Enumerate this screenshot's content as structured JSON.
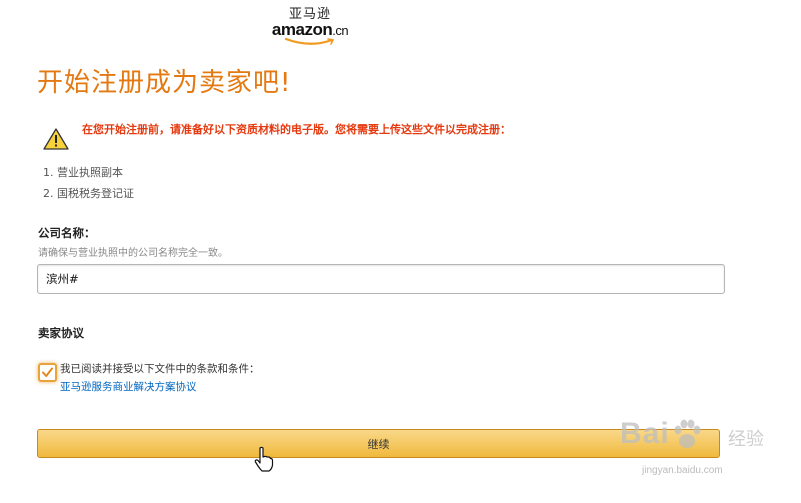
{
  "logo": {
    "cn_text": "亚马逊",
    "brand": "amazon",
    "domain_suffix": ".cn",
    "color": "#111111"
  },
  "page_title": "开始注册成为卖家吧!",
  "warning": {
    "icon": "warning-triangle-icon",
    "text": "在您开始注册前，请准备好以下资质材料的电子版。您将需要上传这些文件以完成注册："
  },
  "documents": [
    "1. 营业执照副本",
    "2. 国税税务登记证"
  ],
  "company": {
    "label": "公司名称：",
    "hint": "请确保与营业执照中的公司名称完全一致。",
    "value": "滨州#"
  },
  "agreement": {
    "section_title": "卖家协议",
    "checkbox_checked": true,
    "checkbox_text": "我已阅读并接受以下文件中的条款和条件：",
    "link_text": "亚马逊服务商业解决方案协议"
  },
  "continue_label": "继续",
  "watermark": {
    "brand": "Bai",
    "brand_suffix": "经验",
    "url": "jingyan.baidu.com"
  },
  "colors": {
    "title_orange": "#e47911",
    "warning_red": "#e53a10",
    "link_blue": "#0066c0",
    "button_gradient_top": "#f9d88a",
    "button_gradient_bottom": "#f0b93d"
  }
}
